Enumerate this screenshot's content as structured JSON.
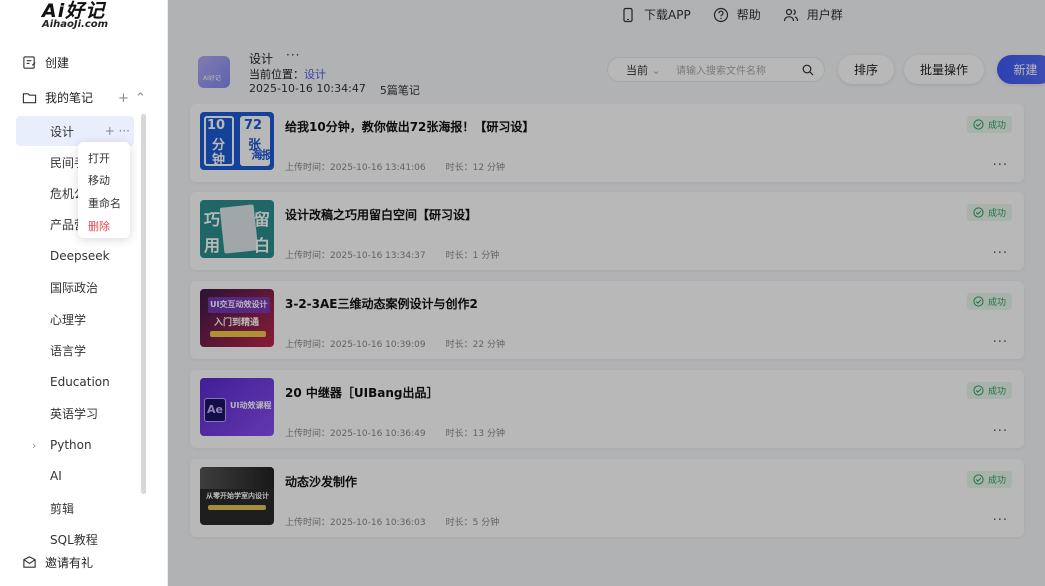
{
  "logo": {
    "main": "Ai好记",
    "sub": "AihaoJi.com"
  },
  "sidebar": {
    "create_label": "创建",
    "my_notes_label": "我的笔记",
    "tree": [
      {
        "label": "设计",
        "active": true
      },
      {
        "label": "民间手"
      },
      {
        "label": "危机公"
      },
      {
        "label": "产品营"
      },
      {
        "label": "Deepseek"
      },
      {
        "label": "国际政治"
      },
      {
        "label": "心理学"
      },
      {
        "label": "语言学"
      },
      {
        "label": "Education"
      },
      {
        "label": "英语学习"
      },
      {
        "label": "Python",
        "expandable": true
      },
      {
        "label": "AI"
      },
      {
        "label": "剪辑"
      },
      {
        "label": "SQL教程"
      }
    ],
    "invite_label": "邀请有礼"
  },
  "context_menu": {
    "items": [
      "打开",
      "移动",
      "重命名",
      "删除"
    ]
  },
  "topbar": {
    "download": "下载APP",
    "help": "帮助",
    "community": "用户群"
  },
  "header": {
    "folder_thumb_text": "AI好记",
    "title": "设计",
    "location_label": "当前位置：",
    "location_value": "设计",
    "datetime": "2025-10-16 10:34:47",
    "count": "5篇笔记"
  },
  "search": {
    "scope": "当前",
    "placeholder": "请输入搜索文件名称"
  },
  "buttons": {
    "sort": "排序",
    "batch": "批量操作",
    "new": "新建"
  },
  "notes": [
    {
      "title": "给我10分钟，教你做出72张海报！【研习设】",
      "upload_label": "上传时间：",
      "upload": "2025-10-16 13:41:06",
      "duration_label": "时长：",
      "duration": "12 分钟",
      "status": "成功",
      "thumb": [
        "10",
        "72",
        "分",
        "张",
        "钟",
        "海",
        "报"
      ]
    },
    {
      "title": "设计改稿之巧用留白空间【研习设】",
      "upload_label": "上传时间：",
      "upload": "2025-10-16 13:34:37",
      "duration_label": "时长：",
      "duration": "1 分钟",
      "status": "成功",
      "thumb": [
        "巧",
        "留",
        "用",
        "白"
      ]
    },
    {
      "title": "3-2-3AE三维动态案例设计与创作2",
      "upload_label": "上传时间：",
      "upload": "2025-10-16 10:39:09",
      "duration_label": "时长：",
      "duration": "22 分钟",
      "status": "成功",
      "thumb": [
        "UI交互动效设计",
        "入门到精通"
      ]
    },
    {
      "title": "20 中继器［UIBang出品］",
      "upload_label": "上传时间：",
      "upload": "2025-10-16 10:36:49",
      "duration_label": "时长：",
      "duration": "13 分钟",
      "status": "成功",
      "thumb": [
        "Ae",
        "UI动效课程"
      ]
    },
    {
      "title": "动态沙发制作",
      "upload_label": "上传时间：",
      "upload": "2025-10-16 10:36:03",
      "duration_label": "时长：",
      "duration": "5 分钟",
      "status": "成功",
      "thumb": [
        "从零开始学室内设计"
      ]
    }
  ],
  "colors": {
    "accent": "#4a5af2",
    "success": "#2f9e5a",
    "danger": "#e5484d"
  }
}
